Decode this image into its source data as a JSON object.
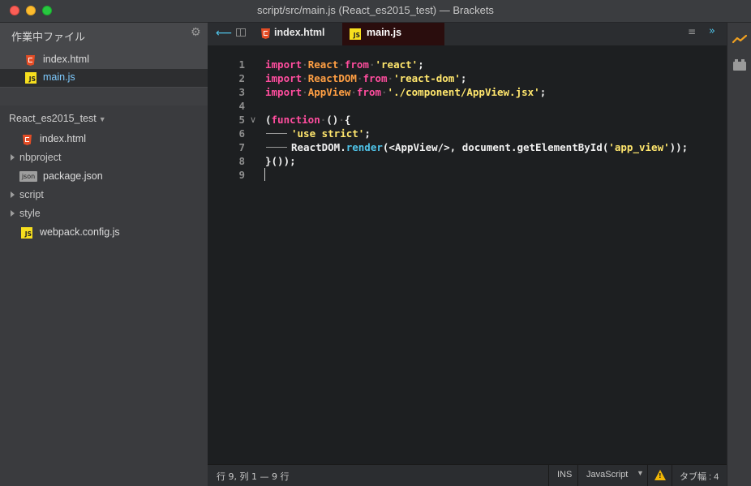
{
  "window": {
    "title": "script/src/main.js (React_es2015_test) — Brackets"
  },
  "sidebar": {
    "working_files_header": "作業中ファイル",
    "working_files": [
      {
        "name": "index.html",
        "icon": "html5-icon",
        "selected": false
      },
      {
        "name": "main.js",
        "icon": "js-icon",
        "selected": true
      }
    ],
    "project_name": "React_es2015_test",
    "tree": [
      {
        "name": "index.html",
        "type": "file",
        "icon": "html5-icon"
      },
      {
        "name": "nbproject",
        "type": "folder"
      },
      {
        "name": "package.json",
        "type": "file",
        "icon": "json-icon",
        "icon_text": "json"
      },
      {
        "name": "script",
        "type": "folder"
      },
      {
        "name": "style",
        "type": "folder"
      },
      {
        "name": "webpack.config.js",
        "type": "file",
        "icon": "js-icon"
      }
    ]
  },
  "tabs": [
    {
      "label": "index.html",
      "icon": "html5-icon",
      "active": false
    },
    {
      "label": "main.js",
      "icon": "js-icon",
      "active": true
    }
  ],
  "icons": {
    "js_badge": "JS"
  },
  "editor": {
    "line_numbers": [
      "1",
      "2",
      "3",
      "4",
      "5",
      "6",
      "7",
      "8",
      "9"
    ],
    "lines": [
      [
        "import",
        "React",
        "from",
        "'react'",
        ";"
      ],
      [
        "import",
        "ReactDOM",
        "from",
        "'react-dom'",
        ";"
      ],
      [
        "import",
        "AppView",
        "from",
        "'./component/AppView.jsx'",
        ";"
      ],
      [],
      [
        "(",
        "function",
        "()",
        "{"
      ],
      [
        "'use strict'",
        ";"
      ],
      [
        "ReactDOM.",
        "render",
        "(<AppView/>, ",
        "document.getElementById(",
        "'app_view'",
        "));"
      ],
      [
        "}());"
      ],
      []
    ]
  },
  "statusbar": {
    "position": "行 9, 列 1 — 9 行",
    "mode": "INS",
    "language": "JavaScript",
    "tab_size": "タブ幅 : 4"
  },
  "colors": {
    "keyword": "#ff4d9e",
    "identifier": "#ff9f43",
    "string": "#ffe66d",
    "function": "#4fc3e8",
    "accent": "#4fc3e8",
    "warning": "#f2b705"
  }
}
